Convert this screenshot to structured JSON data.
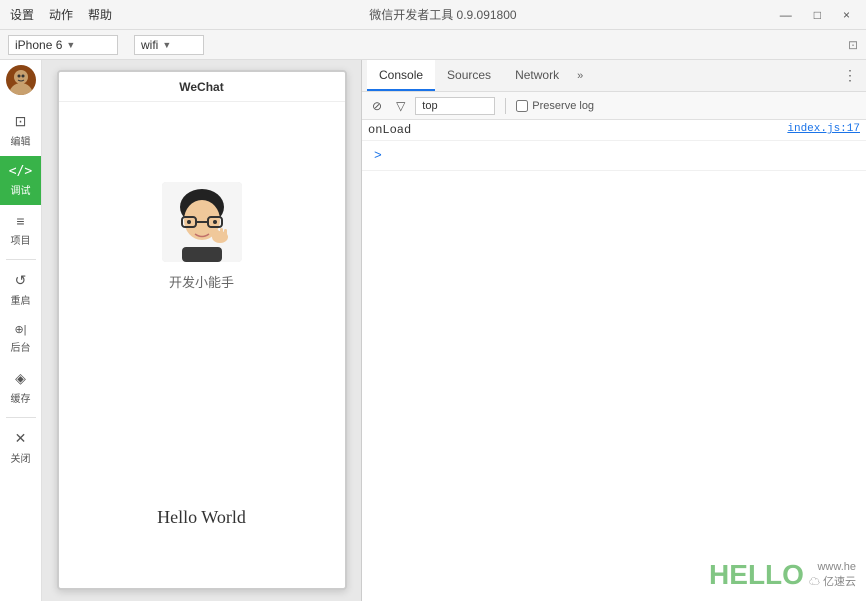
{
  "titlebar": {
    "menu_items": [
      "设置",
      "动作",
      "帮助"
    ],
    "title": "微信开发者工具 0.9.091800",
    "controls": [
      "—",
      "□",
      "×"
    ]
  },
  "toolbar": {
    "device_label": "iPhone 6",
    "network_label": "wifi"
  },
  "sidebar": {
    "avatar_emoji": "👤",
    "items": [
      {
        "id": "editor",
        "icon": "⊡",
        "label": "编辑",
        "active": false
      },
      {
        "id": "debug",
        "icon": "</>",
        "label": "调试",
        "active": true
      },
      {
        "id": "project",
        "icon": "≡",
        "label": "项目",
        "active": false
      },
      {
        "id": "restart",
        "icon": "↺",
        "label": "重启",
        "active": false
      },
      {
        "id": "backend",
        "icon": "⊕|",
        "label": "后台",
        "active": false
      },
      {
        "id": "cache",
        "icon": "◈",
        "label": "缓存",
        "active": false
      },
      {
        "id": "close",
        "icon": "×",
        "label": "关闭",
        "active": false
      }
    ]
  },
  "simulator": {
    "app_title": "WeChat",
    "username": "开发小能手",
    "hello_text": "Hello World"
  },
  "devtools": {
    "tabs": [
      "Console",
      "Sources",
      "Network"
    ],
    "more_label": "»",
    "toolbar": {
      "clear_icon": "⊘",
      "filter_icon": "▽",
      "filter_placeholder": "top",
      "preserve_log_label": "Preserve log"
    },
    "console_entries": [
      {
        "text": "onLoad",
        "source": "index.js:17"
      }
    ],
    "prompt": ">"
  },
  "watermark": {
    "text": "HELLO",
    "site": "www.he",
    "brand": "亿速云"
  }
}
